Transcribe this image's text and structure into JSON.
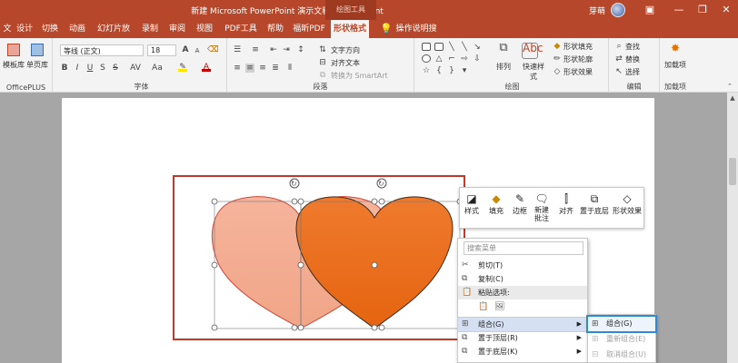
{
  "window": {
    "title": "新建 Microsoft PowerPoint 演示文稿 - PowerPoint",
    "context_tab_group": "绘图工具",
    "user": "芽萌",
    "colors": {
      "accent": "#b7472a",
      "heart_light": "#f2a891",
      "heart_dark": "#ea6b1c",
      "selection": "#d04a3a",
      "highlight_blue": "#2e8ad8"
    }
  },
  "tabs": [
    {
      "label": "文件"
    },
    {
      "label": "设计"
    },
    {
      "label": "切换"
    },
    {
      "label": "动画"
    },
    {
      "label": "幻灯片放映"
    },
    {
      "label": "录制"
    },
    {
      "label": "审阅"
    },
    {
      "label": "视图"
    },
    {
      "label": "PDF工具箱"
    },
    {
      "label": "帮助"
    },
    {
      "label": "福昕PDF"
    },
    {
      "label": "形状格式"
    }
  ],
  "tell_me": "操作说明搜索",
  "ribbon": {
    "officeplus": {
      "btn1": "模板库",
      "btn2": "单页库",
      "label": "OfficePLUS"
    },
    "font": {
      "name": "等线 (正文)",
      "size": "18",
      "label": "字体",
      "bold": "B",
      "italic": "I",
      "underline": "U",
      "strike": "S",
      "shadow": "S",
      "spacing": "AV",
      "case": "Aa"
    },
    "paragraph": {
      "label": "段落",
      "direction": "文字方向",
      "align": "对齐文本",
      "smartart": "转换为 SmartArt"
    },
    "drawing": {
      "label": "绘图",
      "arrange": "排列",
      "quick_styles": "快速样式",
      "fill": "形状填充",
      "outline": "形状轮廓",
      "effects": "形状效果"
    },
    "editing": {
      "label": "编辑",
      "find": "查找",
      "replace": "替换",
      "select": "选择"
    },
    "addins": {
      "btn": "加载项",
      "label": "加载项"
    }
  },
  "mini_toolbar": {
    "items": [
      {
        "label": "样式"
      },
      {
        "label": "填充"
      },
      {
        "label": "边框"
      },
      {
        "label": "新建批注"
      },
      {
        "label": "对齐"
      },
      {
        "label": "置于底层"
      },
      {
        "label": "形状效果"
      }
    ]
  },
  "context_menu": {
    "search_placeholder": "搜索菜单",
    "items": [
      {
        "label": "剪切(T)"
      },
      {
        "label": "复制(C)"
      },
      {
        "label": "粘贴选项:"
      },
      {
        "label": "组合(G)"
      },
      {
        "label": "置于顶层(R)"
      },
      {
        "label": "置于底层(K)"
      }
    ]
  },
  "submenu": {
    "items": [
      {
        "label": "组合(G)"
      },
      {
        "label": "重新组合(E)"
      },
      {
        "label": "取消组合(U)"
      }
    ]
  }
}
